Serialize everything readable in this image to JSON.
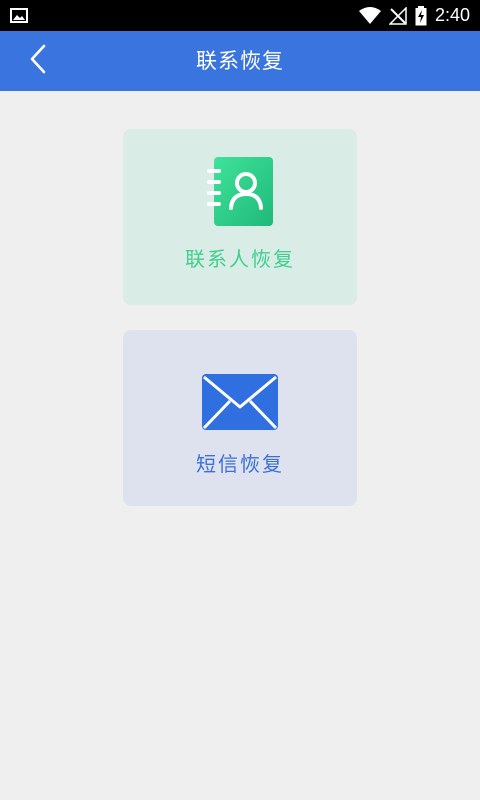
{
  "status_bar": {
    "time": "2:40",
    "icons": [
      "gallery-icon",
      "wifi-icon",
      "no-signal-icon",
      "battery-charging-icon"
    ]
  },
  "app_bar": {
    "title": "联系恢复",
    "back_icon": "chevron-left-icon",
    "background": "#3a74de"
  },
  "cards": {
    "contacts": {
      "label": "联系人恢复",
      "icon": "contact-book-icon",
      "background": "#d9ece6",
      "text_color": "#3fcf8e"
    },
    "sms": {
      "label": "短信恢复",
      "icon": "envelope-icon",
      "background": "#dee2ee",
      "text_color": "#3a6fd8"
    }
  }
}
